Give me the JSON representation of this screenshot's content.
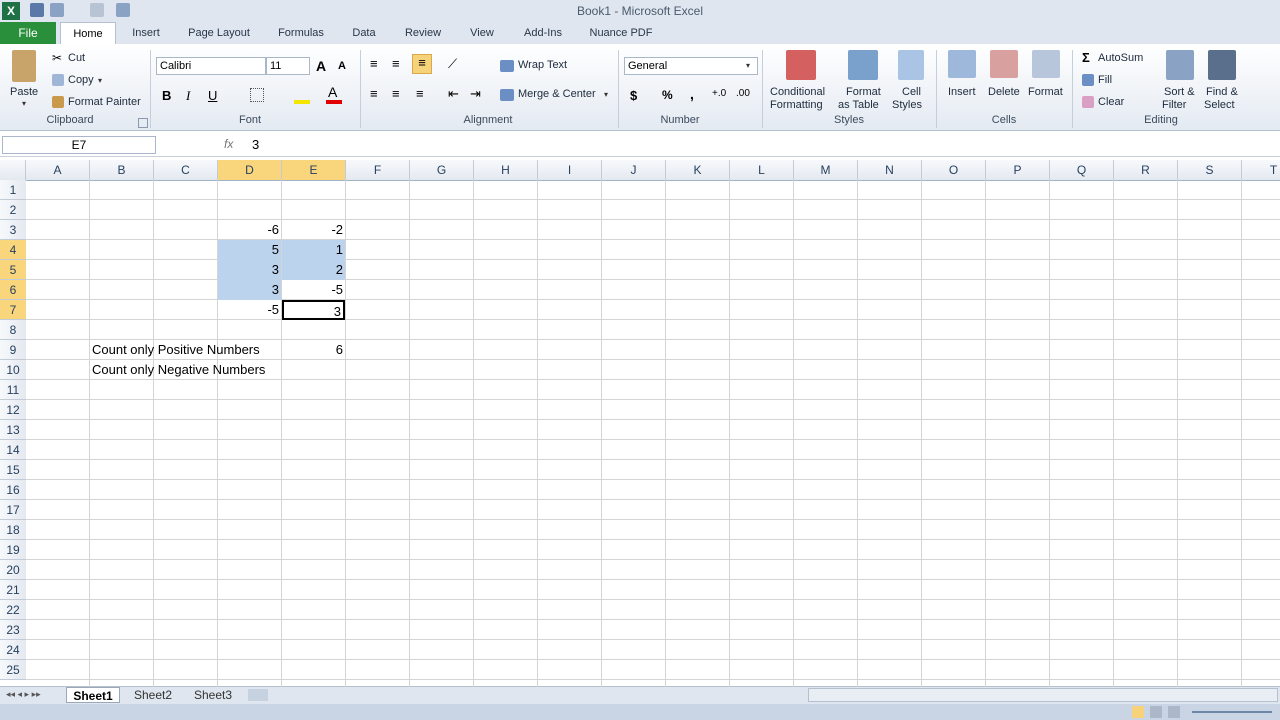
{
  "window": {
    "title": "Book1 - Microsoft Excel",
    "app_icon": "X"
  },
  "tabs": [
    "File",
    "Home",
    "Insert",
    "Page Layout",
    "Formulas",
    "Data",
    "Review",
    "View",
    "Add-Ins",
    "Nuance PDF"
  ],
  "ribbon": {
    "clipboard": {
      "label": "Clipboard",
      "paste": "Paste",
      "cut": "Cut",
      "copy": "Copy",
      "format_painter": "Format Painter"
    },
    "font": {
      "label": "Font",
      "name": "Calibri",
      "size": "11",
      "bold": "B",
      "italic": "I",
      "underline": "U",
      "grow": "A",
      "shrink": "A"
    },
    "alignment": {
      "label": "Alignment",
      "wrap_text": "Wrap Text",
      "merge_center": "Merge & Center"
    },
    "number": {
      "label": "Number",
      "format": "General",
      "currency": "$",
      "percent": "%",
      "comma": ","
    },
    "styles": {
      "label": "Styles",
      "conditional_formatting": [
        "Conditional",
        "Formatting"
      ],
      "format_as_table": [
        "Format",
        "as Table"
      ],
      "cell_styles": [
        "Cell",
        "Styles"
      ]
    },
    "cells": {
      "label": "Cells",
      "insert": "Insert",
      "delete": "Delete",
      "format": "Format"
    },
    "editing": {
      "label": "Editing",
      "autosum": "AutoSum",
      "fill": "Fill",
      "clear": "Clear",
      "sort_filter": [
        "Sort &",
        "Filter"
      ],
      "find_select": [
        "Find &",
        "Select"
      ]
    }
  },
  "formula_bar": {
    "name_box": "E7",
    "fx": "fx",
    "value": "3"
  },
  "columns": [
    "A",
    "B",
    "C",
    "D",
    "E",
    "F",
    "G",
    "H",
    "I",
    "J",
    "K",
    "L",
    "M",
    "N",
    "O",
    "P",
    "Q",
    "R",
    "S",
    "T"
  ],
  "selected_columns": [
    "D",
    "E"
  ],
  "rows": [
    "1",
    "2",
    "3",
    "4",
    "5",
    "6",
    "7",
    "8",
    "9",
    "10",
    "11",
    "12",
    "13",
    "14",
    "15",
    "16",
    "17",
    "18",
    "19",
    "20",
    "21",
    "22",
    "23",
    "24",
    "25"
  ],
  "selected_rows": [
    "4",
    "5",
    "6",
    "7"
  ],
  "cells": {
    "D3": "-6",
    "E3": "-2",
    "D4": "5",
    "E4": "1",
    "D5": "3",
    "E5": "2",
    "D6": "3",
    "E6": "-5",
    "D7": "-5",
    "E7": "3",
    "B9": "Count only Positive Numbers",
    "E9": "6",
    "B10": "Count only Negative Numbers"
  },
  "sheets": [
    "Sheet1",
    "Sheet2",
    "Sheet3"
  ],
  "active_sheet": "Sheet1",
  "colors": {
    "file_tab": "#2a8f3b",
    "selection": "#bcd3ee",
    "header_highlight": "#f9d57b"
  }
}
